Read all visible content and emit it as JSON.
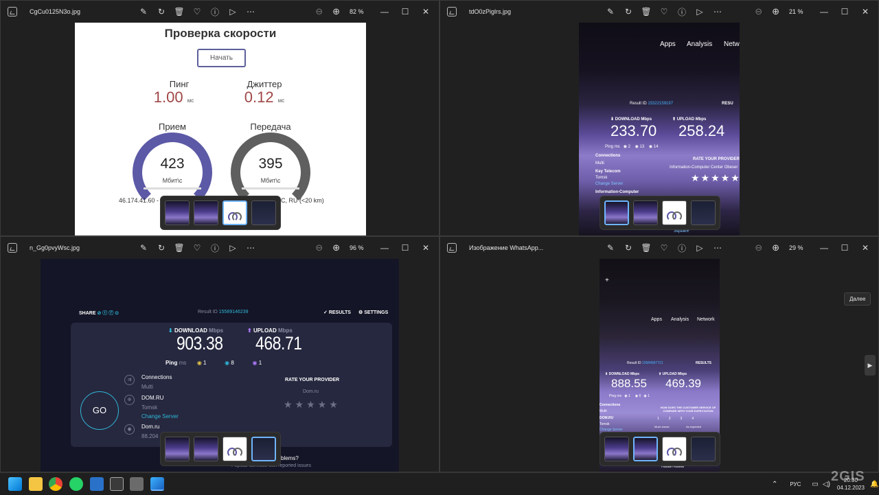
{
  "windows": [
    {
      "filename": "CgCu0125N3o.jpg",
      "zoom": "82 %"
    },
    {
      "filename": "tdO0zPiglrs.jpg",
      "zoom": "21 %"
    },
    {
      "filename": "n_Gg0pvyWsc.jpg",
      "zoom": "96 %"
    },
    {
      "filename": "Изображение WhatsApp...",
      "zoom": "29 %"
    }
  ],
  "icons": [
    "edit-icon",
    "rotate-icon",
    "delete-icon",
    "heart-icon",
    "info-icon",
    "slideshow-icon",
    "more-icon",
    "zoom-out-icon",
    "zoom-in-icon"
  ],
  "speedtest_ru": {
    "title": "Проверка скорости",
    "start_button": "Начать",
    "ping_label": "Пинг",
    "ping_value": "1.00",
    "ping_unit": "мс",
    "jitter_label": "Джиттер",
    "jitter_value": "0.12",
    "jitter_unit": "мс",
    "download_label": "Прием",
    "download_value": "423",
    "download_unit": "Мбит\\с",
    "upload_label": "Передача",
    "upload_value": "395",
    "upload_unit": "Мбит\\с",
    "ip_left": "46.174.41.60 -",
    "ip_right": "C, RU (<20 km)",
    "accent_color": "#5c5f9a",
    "value_color": "#a04646"
  },
  "photo2": {
    "nav": [
      "Apps",
      "Analysis",
      "Netw"
    ],
    "result_id_label": "Result ID",
    "result_id": "15322159197",
    "results": "RESU",
    "download_label": "DOWNLOAD",
    "download_unit": "Mbps",
    "download_value": "233.70",
    "upload_label": "UPLOAD",
    "upload_unit": "Mbps",
    "upload_value": "258.24",
    "ping_label": "Ping",
    "ping_unit": "ms",
    "ping": "2",
    "down_ping": "13",
    "up_ping": "14",
    "connections": "Connections",
    "multi": "Multi",
    "provider": "Key Telecom",
    "city": "Tomsk",
    "change_server": "Change Server",
    "host": "Information-Computer",
    "rate": "RATE YOUR PROVIDER",
    "rate_sub": "Information-Computer Center Obeser",
    "square": "Square"
  },
  "speedtest_en": {
    "share": "SHARE",
    "result_id_label": "Result ID",
    "result_id": "15589146239",
    "results": "RESULTS",
    "settings": "SETTINGS",
    "download_label": "DOWNLOAD",
    "download_unit": "Mbps",
    "download_value": "903.38",
    "upload_label": "UPLOAD",
    "upload_unit": "Mbps",
    "upload_value": "468.71",
    "ping_label": "Ping",
    "ping_unit": "ms",
    "ping": "1",
    "down_ping": "8",
    "up_ping": "1",
    "connections": "Connections",
    "multi": "Multi",
    "provider": "DOM.RU",
    "city": "Tomsk",
    "change_server": "Change Server",
    "host": "Dom.ru",
    "host_ip": "88.204",
    "go": "GO",
    "rate": "RATE YOUR PROVIDER",
    "rate_provider": "Dom.ru",
    "problems": "blems?",
    "popular": "Popular services with reported issues"
  },
  "photo4": {
    "nav": [
      "Apps",
      "Analysis",
      "Network"
    ],
    "result_id_label": "Result ID",
    "result_id": "15584997721",
    "results": "RESULTS",
    "download_label": "DOWNLOAD",
    "download_unit": "Mbps",
    "download_value": "888.55",
    "upload_label": "UPLOAD",
    "upload_unit": "Mbps",
    "upload_value": "469.39",
    "ping_label": "Ping",
    "ping_unit": "ms",
    "ping": "1",
    "down_ping": "6",
    "up_ping": "1",
    "connections": "Connections",
    "multi": "Multi",
    "provider": "DOM.RU",
    "city": "Tomsk",
    "change_server": "Change Server",
    "question": "HOW DOES THE CUSTOMER SERVICE OF COMPARE WITH YOUR EXPECTATION",
    "much_worse": "Much worse",
    "as_expected": "As expected",
    "possible": "Possible Problems"
  },
  "dalee": "Далее",
  "tray": {
    "lang": "РУС",
    "time": "20:30",
    "date": "04.12.2023"
  },
  "watermark": "2GIS"
}
